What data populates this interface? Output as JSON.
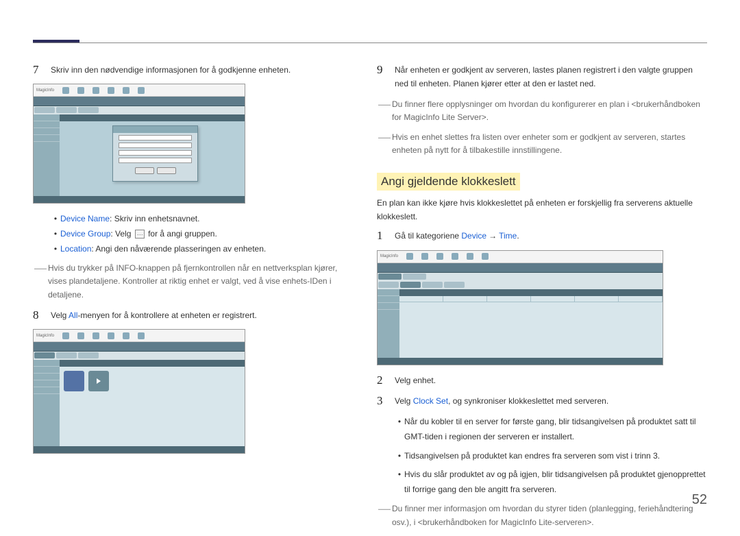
{
  "page_number": "52",
  "left": {
    "step7": {
      "num": "7",
      "text": "Skriv inn den nødvendige informasjonen for å godkjenne enheten."
    },
    "bullets": {
      "device_name": {
        "term": "Device Name",
        "rest": ": Skriv inn enhetsnavnet."
      },
      "device_group": {
        "term": "Device Group",
        "pre": ": Velg ",
        "post": " for å angi gruppen."
      },
      "location": {
        "term": "Location",
        "rest": ": Angi den nåværende plasseringen av enheten."
      }
    },
    "note_info": "Hvis du trykker på INFO-knappen på fjernkontrollen når en nettverksplan kjører, vises plandetaljene. Kontroller at riktig enhet er valgt, ved å vise enhets-IDen i detaljene.",
    "step8": {
      "num": "8",
      "pre": "Velg ",
      "term": "All",
      "post": "-menyen for å kontrollere at enheten er registrert."
    }
  },
  "right": {
    "step9": {
      "num": "9",
      "text": "Når enheten er godkjent av serveren, lastes planen registrert i den valgte gruppen ned til enheten. Planen kjører etter at den er lastet ned."
    },
    "note1": "Du finner flere opplysninger om hvordan du konfigurerer en plan i <brukerhåndboken for MagicInfo Lite Server>.",
    "note2": "Hvis en enhet slettes fra listen over enheter som er godkjent av serveren, startes enheten på nytt for å tilbakestille innstillingene.",
    "section_title": "Angi gjeldende klokkeslett",
    "section_intro": "En plan kan ikke kjøre hvis klokkeslettet på enheten er forskjellig fra serverens aktuelle klokkeslett.",
    "step1": {
      "num": "1",
      "pre": "Gå til kategoriene ",
      "term1": "Device",
      "arrow": "→",
      "term2": "Time",
      "post": "."
    },
    "step2": {
      "num": "2",
      "text": "Velg enhet."
    },
    "step3": {
      "num": "3",
      "pre": "Velg ",
      "term": "Clock Set",
      "post": ", og synkroniser klokkeslettet med serveren."
    },
    "bullets": {
      "b1": "Når du kobler til en server for første gang, blir tidsangivelsen på produktet satt til GMT-tiden i regionen der serveren er installert.",
      "b2": "Tidsangivelsen på produktet kan endres fra serveren som vist i trinn 3.",
      "b3": "Hvis du slår produktet av og på igjen, blir tidsangivelsen på produktet gjenopprettet til forrige gang den ble angitt fra serveren."
    },
    "note3": "Du finner mer informasjon om hvordan du styrer tiden (planlegging, feriehåndtering osv.), i <brukerhåndboken for MagicInfo Lite-serveren>."
  }
}
